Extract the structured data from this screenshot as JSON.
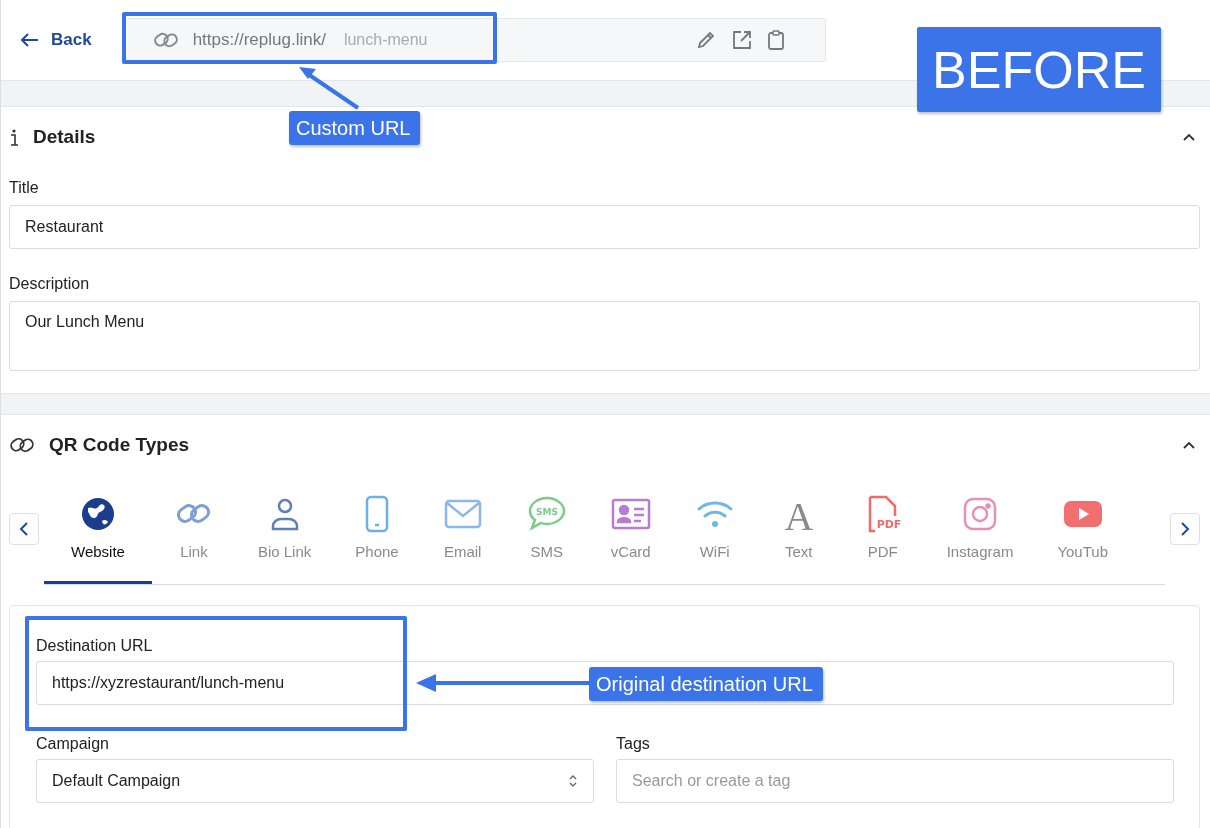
{
  "top_bar": {
    "back": "Back",
    "url": {
      "base": "https://replug.link/",
      "slug": "lunch-menu"
    }
  },
  "details": {
    "heading": "Details",
    "expanded": true,
    "fields": [
      {
        "label": "Title",
        "value": "Restaurant",
        "kind": "input"
      },
      {
        "label": "Description",
        "value": "Our Lunch Menu",
        "kind": "textarea"
      }
    ]
  },
  "qr_types": {
    "heading": "QR Code Types",
    "expanded": true,
    "types": [
      {
        "label": "Website",
        "kind": "globe",
        "color": "#1b3d8c",
        "selected": true
      },
      {
        "label": "Link",
        "kind": "link",
        "color": "#7e9fd6",
        "selected": false
      },
      {
        "label": "Bio Link",
        "kind": "person",
        "color": "#5f7fb6",
        "selected": false
      },
      {
        "label": "Phone",
        "kind": "phone",
        "color": "#6cb0ea",
        "selected": false
      },
      {
        "label": "Email",
        "kind": "mail",
        "color": "#8db6ee",
        "selected": false
      },
      {
        "label": "SMS",
        "kind": "bubble",
        "color": "#7dca8b",
        "selected": false,
        "icon_text": "SMS"
      },
      {
        "label": "vCard",
        "kind": "card",
        "color": "#b87bd6",
        "selected": false
      },
      {
        "label": "WiFi",
        "kind": "wifi",
        "color": "#72b7e2",
        "selected": false
      },
      {
        "label": "Text",
        "kind": "letter",
        "color": "#8a8a8a",
        "selected": false,
        "icon_text": "A"
      },
      {
        "label": "PDF",
        "kind": "file",
        "color": "#ef6b6b",
        "selected": false,
        "icon_text": "PDF"
      },
      {
        "label": "Instagram",
        "kind": "camera",
        "color": "#e690b2",
        "selected": false
      },
      {
        "label": "YouTub",
        "kind": "play",
        "color": "#f26f6f",
        "selected": false
      }
    ]
  },
  "form": {
    "destination": {
      "label": "Destination URL",
      "value": "https://xyzrestaurant/lunch-menu"
    },
    "campaign": {
      "label": "Campaign",
      "value": "Default Campaign"
    },
    "tags": {
      "label": "Tags",
      "placeholder": "Search or create a tag"
    }
  },
  "annotations": {
    "stamp": "BEFORE",
    "url_callout": "Custom URL",
    "destination_callout": "Original destination URL"
  }
}
